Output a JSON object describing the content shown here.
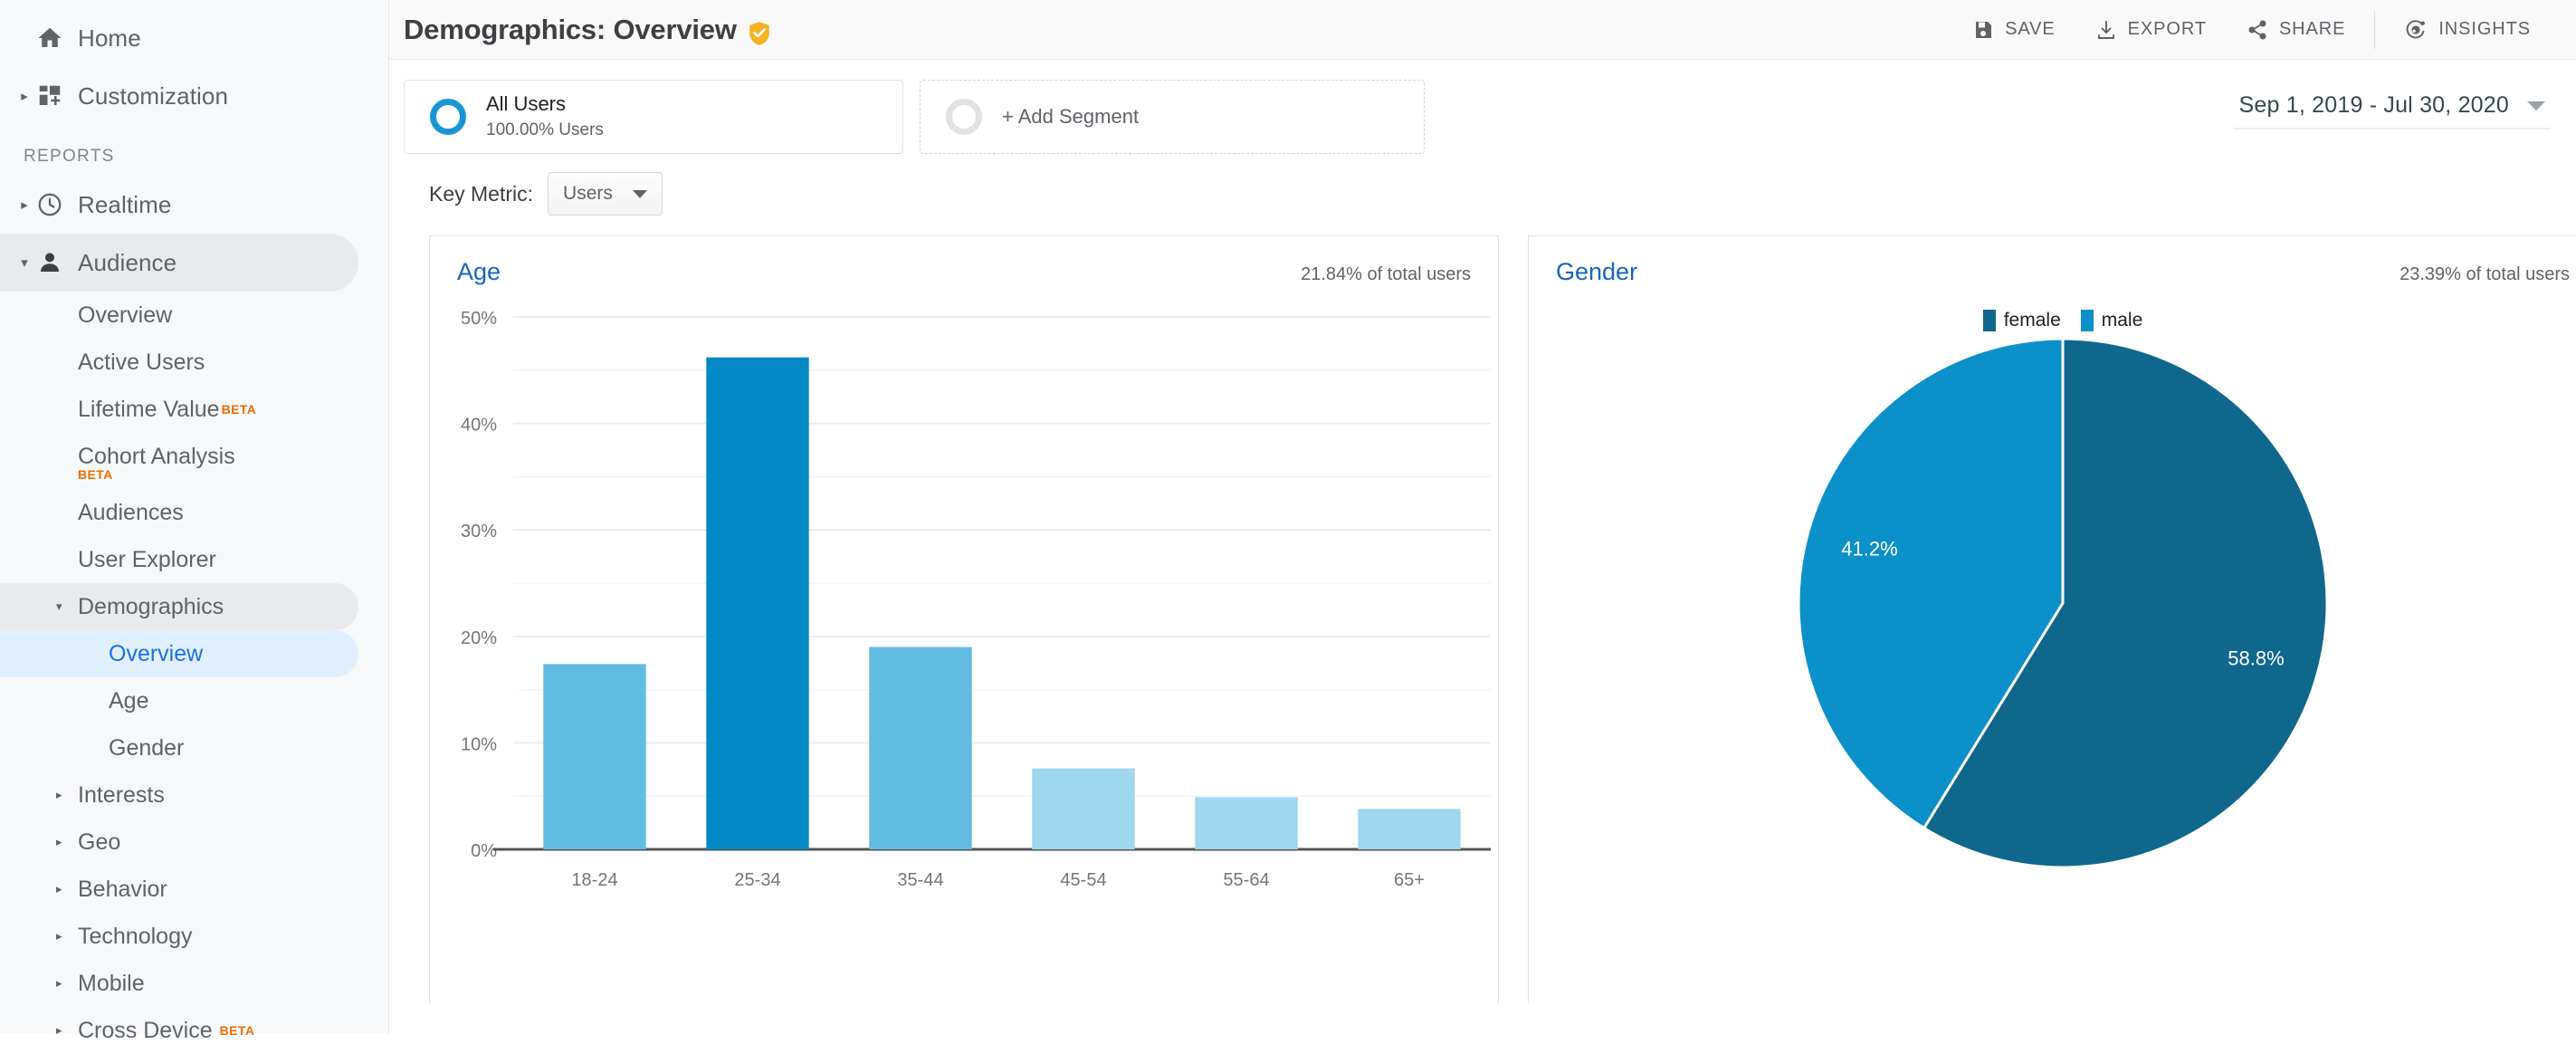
{
  "sidebar": {
    "top_items": [
      {
        "label": "Home",
        "icon": "home-icon",
        "expandable": false,
        "key": "home"
      },
      {
        "label": "Customization",
        "icon": "customization-icon",
        "expandable": true,
        "key": "customization"
      }
    ],
    "section_label": "REPORTS",
    "report_items": [
      {
        "label": "Realtime",
        "icon": "clock-icon",
        "expandable": true,
        "key": "realtime"
      },
      {
        "label": "Audience",
        "icon": "person-icon",
        "expandable": true,
        "key": "audience",
        "selected": true
      }
    ],
    "audience_children": [
      {
        "label": "Overview",
        "key": "overview"
      },
      {
        "label": "Active Users",
        "key": "active-users"
      },
      {
        "label": "Lifetime Value",
        "key": "lifetime-value",
        "badge": "BETA",
        "badge_position": "sup"
      },
      {
        "label": "Cohort Analysis",
        "key": "cohort-analysis",
        "badge": "BETA",
        "badge_position": "below"
      },
      {
        "label": "Audiences",
        "key": "audiences"
      },
      {
        "label": "User Explorer",
        "key": "user-explorer"
      }
    ],
    "demographics": {
      "label": "Demographics",
      "children": [
        {
          "label": "Overview",
          "key": "demographics-overview",
          "active": true
        },
        {
          "label": "Age",
          "key": "demographics-age"
        },
        {
          "label": "Gender",
          "key": "demographics-gender"
        }
      ]
    },
    "bottom_groups": [
      {
        "label": "Interests",
        "key": "interests"
      },
      {
        "label": "Geo",
        "key": "geo"
      },
      {
        "label": "Behavior",
        "key": "behavior"
      },
      {
        "label": "Technology",
        "key": "technology"
      },
      {
        "label": "Mobile",
        "key": "mobile"
      },
      {
        "label": "Cross Device",
        "key": "cross-device",
        "badge": "BETA"
      }
    ]
  },
  "header": {
    "title": "Demographics: Overview",
    "verified_badge_color": "#f5b324",
    "actions": [
      {
        "label": "SAVE",
        "icon": "save-icon",
        "key": "save"
      },
      {
        "label": "EXPORT",
        "icon": "export-icon",
        "key": "export"
      },
      {
        "label": "SHARE",
        "icon": "share-icon",
        "key": "share"
      },
      {
        "label": "INSIGHTS",
        "icon": "insights-icon",
        "key": "insights"
      }
    ]
  },
  "segments": {
    "applied": {
      "title": "All Users",
      "subtitle": "100.00% Users"
    },
    "add_label": "+ Add Segment"
  },
  "date_range": {
    "value": "Sep 1, 2019 - Jul 30, 2020"
  },
  "key_metric": {
    "label": "Key Metric:",
    "value": "Users"
  },
  "chart_data": [
    {
      "type": "bar",
      "panel_title": "Age",
      "panel_meta": "21.84% of total users",
      "categories": [
        "18-24",
        "25-34",
        "35-44",
        "45-54",
        "55-64",
        "65+"
      ],
      "values": [
        17.4,
        46.2,
        19.0,
        7.6,
        4.9,
        3.8
      ],
      "bar_colors": [
        "#62bbe0",
        "#0288c4",
        "#62bbe0",
        "#9ed7ee",
        "#9ed7ee",
        "#9ed7ee"
      ],
      "title": "Age",
      "xlabel": "",
      "ylabel": "",
      "ylim": [
        0,
        50
      ],
      "yticks": [
        0,
        10,
        20,
        30,
        40,
        50
      ],
      "ytick_labels": [
        "0%",
        "10%",
        "20%",
        "30%",
        "40%",
        "50%"
      ],
      "minor_gridlines": [
        5,
        15,
        25,
        35,
        45
      ],
      "grid": true,
      "legend": "none"
    },
    {
      "type": "pie",
      "panel_title": "Gender",
      "panel_meta": "23.39% of total users",
      "title": "Gender",
      "labels": [
        "female",
        "male"
      ],
      "values": [
        58.8,
        41.2
      ],
      "value_labels": [
        "58.8%",
        "41.2%"
      ],
      "colors": [
        "#10678c",
        "#0c90ca"
      ],
      "legend": "top-center"
    }
  ]
}
